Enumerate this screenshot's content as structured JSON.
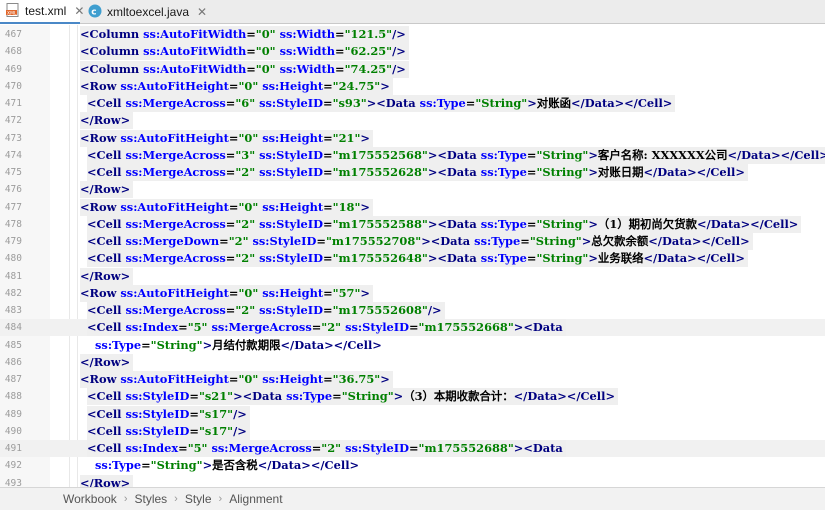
{
  "tabs": [
    {
      "label": "test.xml",
      "active": true,
      "icon": "xml-file-icon"
    },
    {
      "label": "xmltoexcel.java",
      "active": false,
      "icon": "java-class-icon"
    }
  ],
  "lines": [
    {
      "num": "467",
      "indent": 1,
      "tokens": [
        [
          "tag",
          "<Column "
        ],
        [
          "attr",
          "ss:AutoFitWidth"
        ],
        [
          "plain",
          "="
        ],
        [
          "val",
          "\"0\""
        ],
        [
          "plain",
          " "
        ],
        [
          "attr",
          "ss:Width"
        ],
        [
          "plain",
          "="
        ],
        [
          "val",
          "\"121.5\""
        ],
        [
          "tag",
          "/>"
        ]
      ]
    },
    {
      "num": "468",
      "indent": 1,
      "tokens": [
        [
          "tag",
          "<Column "
        ],
        [
          "attr",
          "ss:AutoFitWidth"
        ],
        [
          "plain",
          "="
        ],
        [
          "val",
          "\"0\""
        ],
        [
          "plain",
          " "
        ],
        [
          "attr",
          "ss:Width"
        ],
        [
          "plain",
          "="
        ],
        [
          "val",
          "\"62.25\""
        ],
        [
          "tag",
          "/>"
        ]
      ]
    },
    {
      "num": "469",
      "indent": 1,
      "tokens": [
        [
          "tag",
          "<Column "
        ],
        [
          "attr",
          "ss:AutoFitWidth"
        ],
        [
          "plain",
          "="
        ],
        [
          "val",
          "\"0\""
        ],
        [
          "plain",
          " "
        ],
        [
          "attr",
          "ss:Width"
        ],
        [
          "plain",
          "="
        ],
        [
          "val",
          "\"74.25\""
        ],
        [
          "tag",
          "/>"
        ]
      ]
    },
    {
      "num": "470",
      "indent": 1,
      "tokens": [
        [
          "tag",
          "<Row "
        ],
        [
          "attr",
          "ss:AutoFitHeight"
        ],
        [
          "plain",
          "="
        ],
        [
          "val",
          "\"0\""
        ],
        [
          "plain",
          " "
        ],
        [
          "attr",
          "ss:Height"
        ],
        [
          "plain",
          "="
        ],
        [
          "val",
          "\"24.75\""
        ],
        [
          "tag",
          ">"
        ]
      ]
    },
    {
      "num": "471",
      "indent": 2,
      "tokens": [
        [
          "tag",
          "<Cell "
        ],
        [
          "attr",
          "ss:MergeAcross"
        ],
        [
          "plain",
          "="
        ],
        [
          "val",
          "\"6\""
        ],
        [
          "plain",
          " "
        ],
        [
          "attr",
          "ss:StyleID"
        ],
        [
          "plain",
          "="
        ],
        [
          "val",
          "\"s93\""
        ],
        [
          "tag",
          "><Data "
        ],
        [
          "attr",
          "ss:Type"
        ],
        [
          "plain",
          "="
        ],
        [
          "val",
          "\"String\""
        ],
        [
          "tag",
          ">"
        ],
        [
          "plain",
          "对账函"
        ],
        [
          "tag",
          "</Data></Cell>"
        ]
      ]
    },
    {
      "num": "472",
      "indent": 1,
      "tokens": [
        [
          "tag",
          "</Row>"
        ]
      ]
    },
    {
      "num": "473",
      "indent": 1,
      "tokens": [
        [
          "tag",
          "<Row "
        ],
        [
          "attr",
          "ss:AutoFitHeight"
        ],
        [
          "plain",
          "="
        ],
        [
          "val",
          "\"0\""
        ],
        [
          "plain",
          " "
        ],
        [
          "attr",
          "ss:Height"
        ],
        [
          "plain",
          "="
        ],
        [
          "val",
          "\"21\""
        ],
        [
          "tag",
          ">"
        ]
      ]
    },
    {
      "num": "474",
      "indent": 2,
      "tokens": [
        [
          "tag",
          "<Cell "
        ],
        [
          "attr",
          "ss:MergeAcross"
        ],
        [
          "plain",
          "="
        ],
        [
          "val",
          "\"3\""
        ],
        [
          "plain",
          " "
        ],
        [
          "attr",
          "ss:StyleID"
        ],
        [
          "plain",
          "="
        ],
        [
          "val",
          "\"m175552568\""
        ],
        [
          "tag",
          "><Data "
        ],
        [
          "attr",
          "ss:Type"
        ],
        [
          "plain",
          "="
        ],
        [
          "val",
          "\"String\""
        ],
        [
          "tag",
          ">"
        ],
        [
          "plain",
          "客户名称: XXXXXX公司"
        ],
        [
          "tag",
          "</Data></Cell>"
        ]
      ]
    },
    {
      "num": "475",
      "indent": 2,
      "tokens": [
        [
          "tag",
          "<Cell "
        ],
        [
          "attr",
          "ss:MergeAcross"
        ],
        [
          "plain",
          "="
        ],
        [
          "val",
          "\"2\""
        ],
        [
          "plain",
          " "
        ],
        [
          "attr",
          "ss:StyleID"
        ],
        [
          "plain",
          "="
        ],
        [
          "val",
          "\"m175552628\""
        ],
        [
          "tag",
          "><Data "
        ],
        [
          "attr",
          "ss:Type"
        ],
        [
          "plain",
          "="
        ],
        [
          "val",
          "\"String\""
        ],
        [
          "tag",
          ">"
        ],
        [
          "plain",
          "对账日期"
        ],
        [
          "tag",
          "</Data></Cell>"
        ]
      ]
    },
    {
      "num": "476",
      "indent": 1,
      "tokens": [
        [
          "tag",
          "</Row>"
        ]
      ]
    },
    {
      "num": "477",
      "indent": 1,
      "tokens": [
        [
          "tag",
          "<Row "
        ],
        [
          "attr",
          "ss:AutoFitHeight"
        ],
        [
          "plain",
          "="
        ],
        [
          "val",
          "\"0\""
        ],
        [
          "plain",
          " "
        ],
        [
          "attr",
          "ss:Height"
        ],
        [
          "plain",
          "="
        ],
        [
          "val",
          "\"18\""
        ],
        [
          "tag",
          ">"
        ]
      ]
    },
    {
      "num": "478",
      "indent": 2,
      "tokens": [
        [
          "tag",
          "<Cell "
        ],
        [
          "attr",
          "ss:MergeAcross"
        ],
        [
          "plain",
          "="
        ],
        [
          "val",
          "\"2\""
        ],
        [
          "plain",
          " "
        ],
        [
          "attr",
          "ss:StyleID"
        ],
        [
          "plain",
          "="
        ],
        [
          "val",
          "\"m175552588\""
        ],
        [
          "tag",
          "><Data "
        ],
        [
          "attr",
          "ss:Type"
        ],
        [
          "plain",
          "="
        ],
        [
          "val",
          "\"String\""
        ],
        [
          "tag",
          ">"
        ],
        [
          "plain",
          "（1）期初尚欠货款"
        ],
        [
          "tag",
          "</Data></Cell>"
        ]
      ]
    },
    {
      "num": "479",
      "indent": 2,
      "tokens": [
        [
          "tag",
          "<Cell "
        ],
        [
          "attr",
          "ss:MergeDown"
        ],
        [
          "plain",
          "="
        ],
        [
          "val",
          "\"2\""
        ],
        [
          "plain",
          " "
        ],
        [
          "attr",
          "ss:StyleID"
        ],
        [
          "plain",
          "="
        ],
        [
          "val",
          "\"m175552708\""
        ],
        [
          "tag",
          "><Data "
        ],
        [
          "attr",
          "ss:Type"
        ],
        [
          "plain",
          "="
        ],
        [
          "val",
          "\"String\""
        ],
        [
          "tag",
          ">"
        ],
        [
          "plain",
          "总欠款余额"
        ],
        [
          "tag",
          "</Data></Cell>"
        ]
      ]
    },
    {
      "num": "480",
      "indent": 2,
      "tokens": [
        [
          "tag",
          "<Cell "
        ],
        [
          "attr",
          "ss:MergeAcross"
        ],
        [
          "plain",
          "="
        ],
        [
          "val",
          "\"2\""
        ],
        [
          "plain",
          " "
        ],
        [
          "attr",
          "ss:StyleID"
        ],
        [
          "plain",
          "="
        ],
        [
          "val",
          "\"m175552648\""
        ],
        [
          "tag",
          "><Data "
        ],
        [
          "attr",
          "ss:Type"
        ],
        [
          "plain",
          "="
        ],
        [
          "val",
          "\"String\""
        ],
        [
          "tag",
          ">"
        ],
        [
          "plain",
          "业务联络"
        ],
        [
          "tag",
          "</Data></Cell>"
        ]
      ]
    },
    {
      "num": "481",
      "indent": 1,
      "tokens": [
        [
          "tag",
          "</Row>"
        ]
      ]
    },
    {
      "num": "482",
      "indent": 1,
      "tokens": [
        [
          "tag",
          "<Row "
        ],
        [
          "attr",
          "ss:AutoFitHeight"
        ],
        [
          "plain",
          "="
        ],
        [
          "val",
          "\"0\""
        ],
        [
          "plain",
          " "
        ],
        [
          "attr",
          "ss:Height"
        ],
        [
          "plain",
          "="
        ],
        [
          "val",
          "\"57\""
        ],
        [
          "tag",
          ">"
        ]
      ]
    },
    {
      "num": "483",
      "indent": 2,
      "tokens": [
        [
          "tag",
          "<Cell "
        ],
        [
          "attr",
          "ss:MergeAcross"
        ],
        [
          "plain",
          "="
        ],
        [
          "val",
          "\"2\""
        ],
        [
          "plain",
          " "
        ],
        [
          "attr",
          "ss:StyleID"
        ],
        [
          "plain",
          "="
        ],
        [
          "val",
          "\"m175552608\""
        ],
        [
          "tag",
          "/>"
        ]
      ]
    },
    {
      "num": "484",
      "indent": 2,
      "highlight": true,
      "tokens": [
        [
          "tag",
          "<Cell "
        ],
        [
          "attr",
          "ss:Index"
        ],
        [
          "plain",
          "="
        ],
        [
          "val",
          "\"5\""
        ],
        [
          "plain",
          " "
        ],
        [
          "attr",
          "ss:MergeAcross"
        ],
        [
          "plain",
          "="
        ],
        [
          "val",
          "\"2\""
        ],
        [
          "plain",
          " "
        ],
        [
          "attr",
          "ss:StyleID"
        ],
        [
          "plain",
          "="
        ],
        [
          "val",
          "\"m175552668\""
        ],
        [
          "tag",
          "><Data"
        ]
      ]
    },
    {
      "num": "485",
      "indent": 3,
      "tokens": [
        [
          "attr",
          "ss:Type"
        ],
        [
          "plain",
          "="
        ],
        [
          "val",
          "\"String\""
        ],
        [
          "tag",
          ">"
        ],
        [
          "plain",
          "月结付款期限"
        ],
        [
          "tag",
          "</Data></Cell>"
        ]
      ]
    },
    {
      "num": "486",
      "indent": 1,
      "tokens": [
        [
          "tag",
          "</Row>"
        ]
      ]
    },
    {
      "num": "487",
      "indent": 1,
      "tokens": [
        [
          "tag",
          "<Row "
        ],
        [
          "attr",
          "ss:AutoFitHeight"
        ],
        [
          "plain",
          "="
        ],
        [
          "val",
          "\"0\""
        ],
        [
          "plain",
          " "
        ],
        [
          "attr",
          "ss:Height"
        ],
        [
          "plain",
          "="
        ],
        [
          "val",
          "\"36.75\""
        ],
        [
          "tag",
          ">"
        ]
      ]
    },
    {
      "num": "488",
      "indent": 2,
      "tokens": [
        [
          "tag",
          "<Cell "
        ],
        [
          "attr",
          "ss:StyleID"
        ],
        [
          "plain",
          "="
        ],
        [
          "val",
          "\"s21\""
        ],
        [
          "tag",
          "><Data "
        ],
        [
          "attr",
          "ss:Type"
        ],
        [
          "plain",
          "="
        ],
        [
          "val",
          "\"String\""
        ],
        [
          "tag",
          ">"
        ],
        [
          "plain",
          "（3）本期收款合计："
        ],
        [
          "tag",
          "</Data></Cell>"
        ]
      ]
    },
    {
      "num": "489",
      "indent": 2,
      "tokens": [
        [
          "tag",
          "<Cell "
        ],
        [
          "attr",
          "ss:StyleID"
        ],
        [
          "plain",
          "="
        ],
        [
          "val",
          "\"s17\""
        ],
        [
          "tag",
          "/>"
        ]
      ]
    },
    {
      "num": "490",
      "indent": 2,
      "tokens": [
        [
          "tag",
          "<Cell "
        ],
        [
          "attr",
          "ss:StyleID"
        ],
        [
          "plain",
          "="
        ],
        [
          "val",
          "\"s17\""
        ],
        [
          "tag",
          "/>"
        ]
      ]
    },
    {
      "num": "491",
      "indent": 2,
      "highlight": true,
      "tokens": [
        [
          "tag",
          "<Cell "
        ],
        [
          "attr",
          "ss:Index"
        ],
        [
          "plain",
          "="
        ],
        [
          "val",
          "\"5\""
        ],
        [
          "plain",
          " "
        ],
        [
          "attr",
          "ss:MergeAcross"
        ],
        [
          "plain",
          "="
        ],
        [
          "val",
          "\"2\""
        ],
        [
          "plain",
          " "
        ],
        [
          "attr",
          "ss:StyleID"
        ],
        [
          "plain",
          "="
        ],
        [
          "val",
          "\"m175552688\""
        ],
        [
          "tag",
          "><Data"
        ]
      ]
    },
    {
      "num": "492",
      "indent": 3,
      "tokens": [
        [
          "attr",
          "ss:Type"
        ],
        [
          "plain",
          "="
        ],
        [
          "val",
          "\"String\""
        ],
        [
          "tag",
          ">"
        ],
        [
          "plain",
          "是否含税"
        ],
        [
          "tag",
          "</Data></Cell>"
        ]
      ]
    },
    {
      "num": "493",
      "indent": 1,
      "tokens": [
        [
          "tag",
          "</Row>"
        ]
      ]
    }
  ],
  "breadcrumb": [
    "Workbook",
    "Styles",
    "Style",
    "Alignment"
  ],
  "colors": {
    "tag": "#000080",
    "attr": "#0000ff",
    "value": "#008000",
    "text": "#000000",
    "tab_accent": "#4a88c7"
  }
}
